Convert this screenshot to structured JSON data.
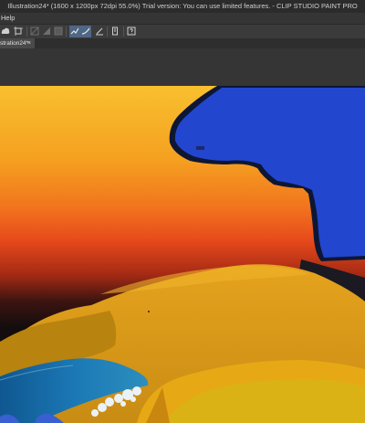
{
  "window": {
    "title": "Illustration24* (1600 x 1200px 72dpi 55.0%)  Trial version: You can use limited features. - CLIP STUDIO PAINT PRO"
  },
  "menu": {
    "items": [
      "Help"
    ]
  },
  "toolbar": {
    "icons": [
      "cloud-save-icon",
      "transform-icon",
      "select-icon",
      "deselect-icon",
      "fill-icon",
      "stroke-icon",
      "correct-line-icon",
      "pen-settings-icon",
      "device-icon",
      "help-icon"
    ]
  },
  "document_tab": {
    "label": "stration24*",
    "close": "×"
  },
  "colors": {
    "sky_top": "#f6b52a",
    "sky_mid": "#f2711e",
    "sky_low": "#e4431a",
    "dark_band": "#130d0e",
    "blue_shape": "#2346cf",
    "sand": "#d79a17",
    "water": "#1b6ea8"
  }
}
